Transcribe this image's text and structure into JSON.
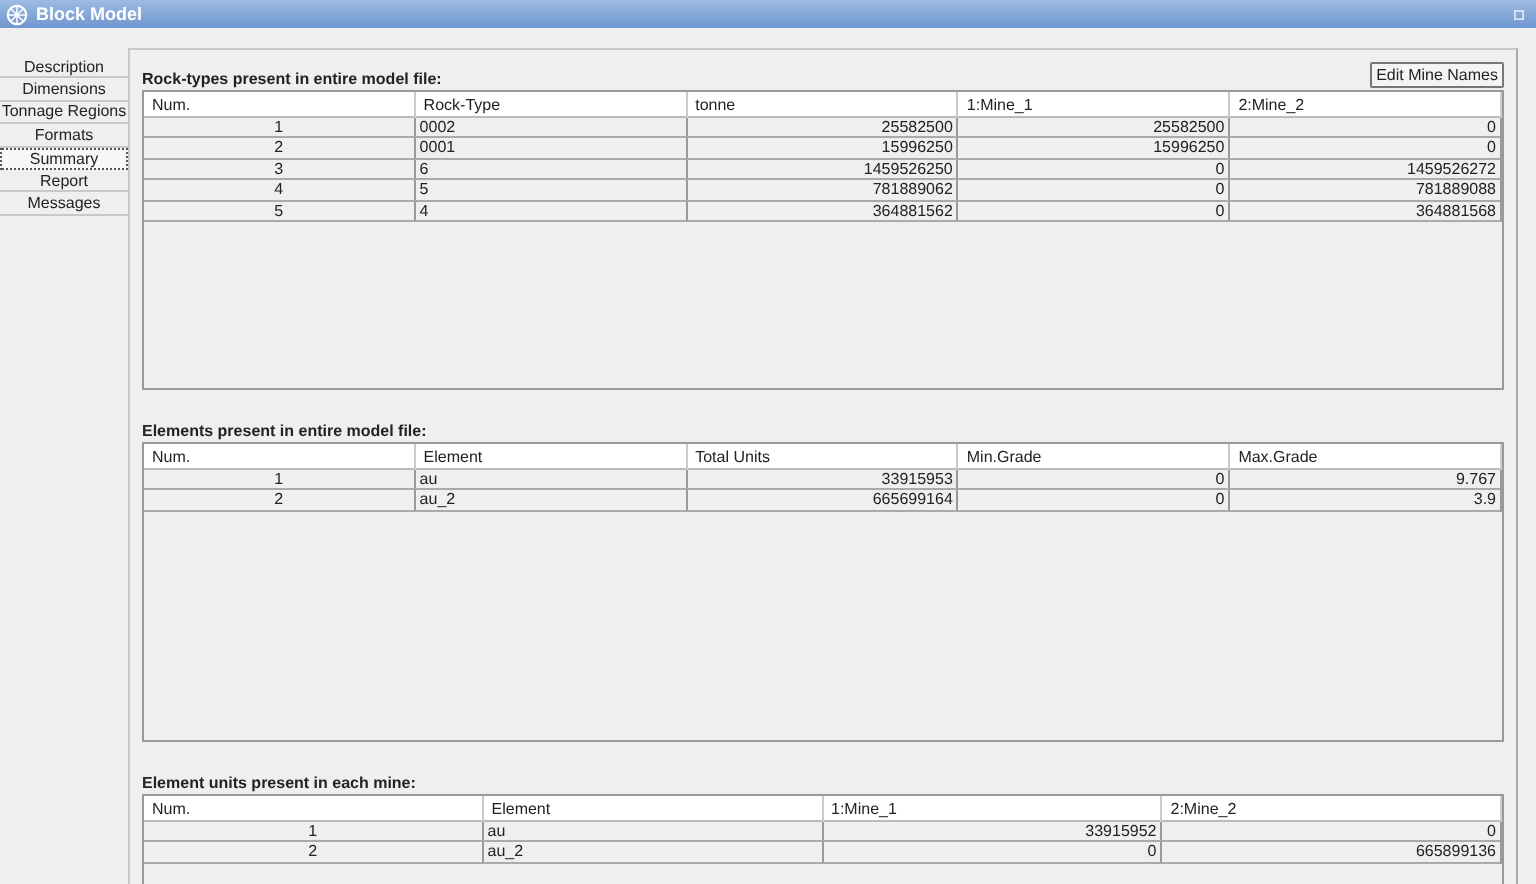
{
  "window": {
    "title": "Block Model"
  },
  "sidebar": {
    "items": [
      {
        "label": "Description",
        "selected": false
      },
      {
        "label": "Dimensions",
        "selected": false
      },
      {
        "label": "Tonnage Regions",
        "selected": false
      },
      {
        "label": "Formats",
        "selected": false
      },
      {
        "label": "Summary",
        "selected": true
      },
      {
        "label": "Report",
        "selected": false
      },
      {
        "label": "Messages",
        "selected": false
      }
    ]
  },
  "edit_button": "Edit Mine Names",
  "sections": [
    {
      "heading": "Rock-types present in entire model file:",
      "columns": [
        {
          "label": "Num.",
          "kind": "index"
        },
        {
          "label": "Rock-Type",
          "kind": "text"
        },
        {
          "label": "tonne",
          "kind": "number"
        },
        {
          "label": "1:Mine_1",
          "kind": "number"
        },
        {
          "label": "2:Mine_2",
          "kind": "number"
        }
      ],
      "rows": [
        [
          "1",
          "0002",
          "25582500",
          "25582500",
          "0"
        ],
        [
          "2",
          "0001",
          "15996250",
          "15996250",
          "0"
        ],
        [
          "3",
          "6",
          "1459526250",
          "0",
          "1459526272"
        ],
        [
          "4",
          "5",
          "781889062",
          "0",
          "781889088"
        ],
        [
          "5",
          "4",
          "364881562",
          "0",
          "364881568"
        ]
      ]
    },
    {
      "heading": "Elements present in entire model file:",
      "columns": [
        {
          "label": "Num.",
          "kind": "index"
        },
        {
          "label": "Element",
          "kind": "text"
        },
        {
          "label": "Total Units",
          "kind": "number"
        },
        {
          "label": "Min.Grade",
          "kind": "number"
        },
        {
          "label": "Max.Grade",
          "kind": "number"
        }
      ],
      "rows": [
        [
          "1",
          "au",
          "33915953",
          "0",
          "9.767"
        ],
        [
          "2",
          "au_2",
          "665699164",
          "0",
          "3.9"
        ]
      ]
    },
    {
      "heading": "Element units present in each mine:",
      "columns": [
        {
          "label": "Num.",
          "kind": "index"
        },
        {
          "label": "Element",
          "kind": "text"
        },
        {
          "label": "1:Mine_1",
          "kind": "number"
        },
        {
          "label": "2:Mine_2",
          "kind": "number"
        }
      ],
      "rows": [
        [
          "1",
          "au",
          "33915952",
          "0"
        ],
        [
          "2",
          "au_2",
          "0",
          "665899136"
        ]
      ]
    }
  ]
}
